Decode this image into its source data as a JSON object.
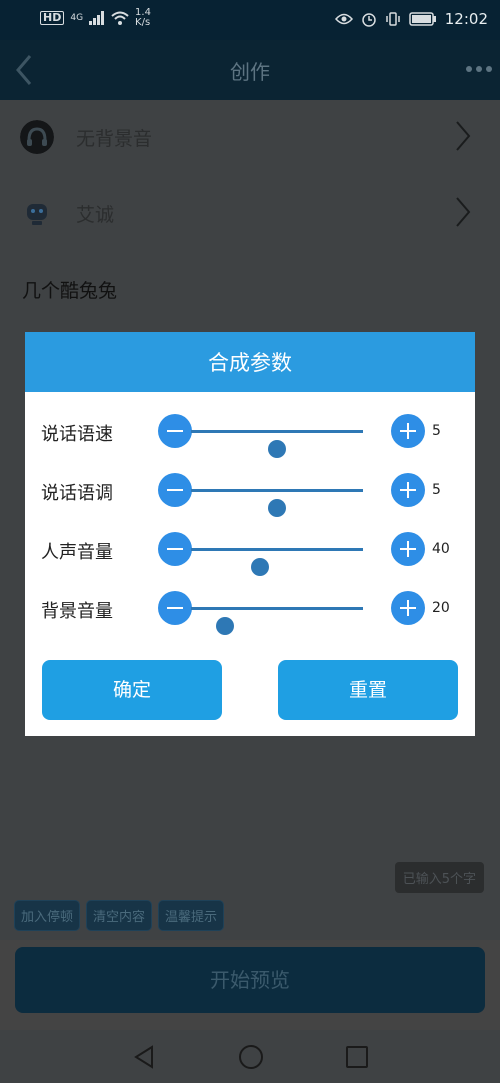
{
  "status_bar": {
    "hd": "HD",
    "network": "4G",
    "speed_value": "1.4",
    "speed_unit": "K/s",
    "time": "12:02"
  },
  "header": {
    "title": "创作"
  },
  "settings_rows": [
    {
      "label": "无背景音"
    },
    {
      "label": "艾诚"
    }
  ],
  "content_title": "几个酷兔兔",
  "dialog": {
    "title": "合成参数",
    "params": [
      {
        "label": "说话语速",
        "value": "5",
        "level": 0.5
      },
      {
        "label": "说话语调",
        "value": "5",
        "level": 0.5
      },
      {
        "label": "人声音量",
        "value": "40",
        "level": 0.4
      },
      {
        "label": "背景音量",
        "value": "20",
        "level": 0.2
      }
    ],
    "confirm_label": "确定",
    "reset_label": "重置"
  },
  "bottom": {
    "count_badge": "已输入5个字",
    "chips": [
      "加入停顿",
      "清空内容",
      "温馨提示"
    ],
    "preview_label": "开始预览"
  },
  "colors": {
    "accent": "#2b9be0",
    "button": "#2e8ee6",
    "slider": "#2e78b5"
  }
}
